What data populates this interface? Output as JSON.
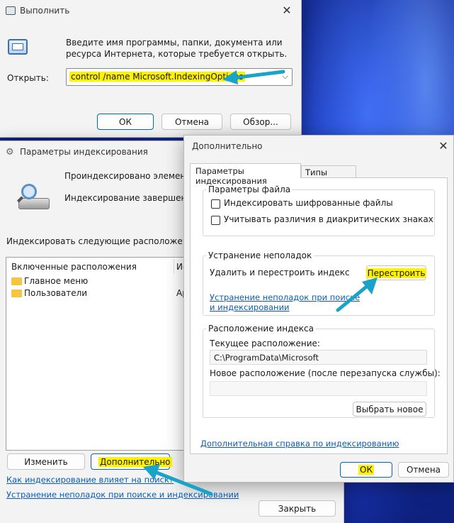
{
  "run_dialog": {
    "title": "Выполнить",
    "description": "Введите имя программы, папки, документа или ресурса Интернета, которые требуется открыть.",
    "open_label": "Открыть:",
    "command_value": "control /name Microsoft.IndexingOptions",
    "ok": "ОК",
    "cancel": "Отмена",
    "browse": "Обзор..."
  },
  "indexing_dialog": {
    "title": "Параметры индексирования",
    "indexed_count": "Проиндексировано элементов: 1",
    "status": "Индексирование завершено.",
    "locations_caption": "Индексировать следующие расположения:",
    "list": {
      "columns": [
        "Включенные расположения",
        "Ис"
      ],
      "rows": [
        {
          "name": "Главное меню",
          "extra": ""
        },
        {
          "name": "Пользователи",
          "extra": "Ар"
        }
      ]
    },
    "modify": "Изменить",
    "advanced": "Дополнительно",
    "links": [
      "Как индексирование влияет на поиск?",
      "Устранение неполадок при поиске и индексировании"
    ],
    "close": "Закрыть"
  },
  "advanced_dialog": {
    "title": "Дополнительно",
    "tabs": [
      "Параметры индексирования",
      "Типы файлов"
    ],
    "file_settings": {
      "legend": "Параметры файла",
      "checkboxes": [
        "Индексировать шифрованные файлы",
        "Учитывать различия в диакритических знаках"
      ]
    },
    "troubleshooting": {
      "legend": "Устранение неполадок",
      "label": "Удалить и перестроить индекс",
      "rebuild": "Перестроить",
      "link": "Устранение неполадок при поиске и индексировании"
    },
    "index_location": {
      "legend": "Расположение индекса",
      "current_label": "Текущее расположение:",
      "current_value": "C:\\ProgramData\\Microsoft",
      "new_label": "Новое расположение (после перезапуска службы):",
      "new_value": "",
      "select_new": "Выбрать новое"
    },
    "help_link": "Дополнительная справка по индексированию",
    "ok": "ОК",
    "cancel": "Отмена"
  },
  "colors": {
    "highlight": "#fff200",
    "arrow": "#1aa3c8",
    "link": "#0a5cb8",
    "accent": "#0067c0"
  }
}
